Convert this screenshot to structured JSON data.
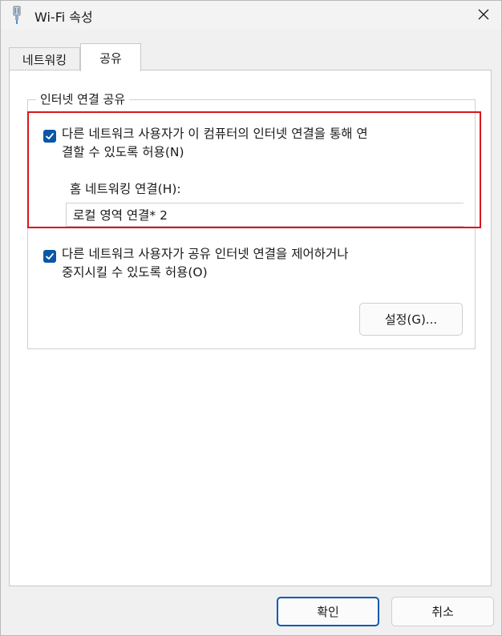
{
  "window": {
    "title": "Wi-Fi 속성"
  },
  "tabs": [
    {
      "label": "네트워킹",
      "active": false
    },
    {
      "label": "공유",
      "active": true
    }
  ],
  "sharing": {
    "group_title": "인터넷 연결 공유",
    "allow_connect": {
      "checked": true,
      "label_line1": "다른 네트워크 사용자가 이 컴퓨터의 인터넷 연결을 통해 연",
      "label_line2": "결할 수 있도록 허용(N)"
    },
    "home_network": {
      "label": "홈 네트워킹 연결(H):",
      "selected": "로컬 영역 연결* 2"
    },
    "allow_control": {
      "checked": true,
      "label_line1": "다른 네트워크 사용자가 공유 인터넷 연결을 제어하거나",
      "label_line2": "중지시킬 수 있도록 허용(O)"
    },
    "settings_button": "설정(G)..."
  },
  "footer": {
    "ok_label": "확인",
    "cancel_label": "취소"
  },
  "colors": {
    "accent": "#0b57a6",
    "highlight": "#d8161e",
    "panel_bg": "#ffffff",
    "window_bg": "#f0f0f0"
  }
}
